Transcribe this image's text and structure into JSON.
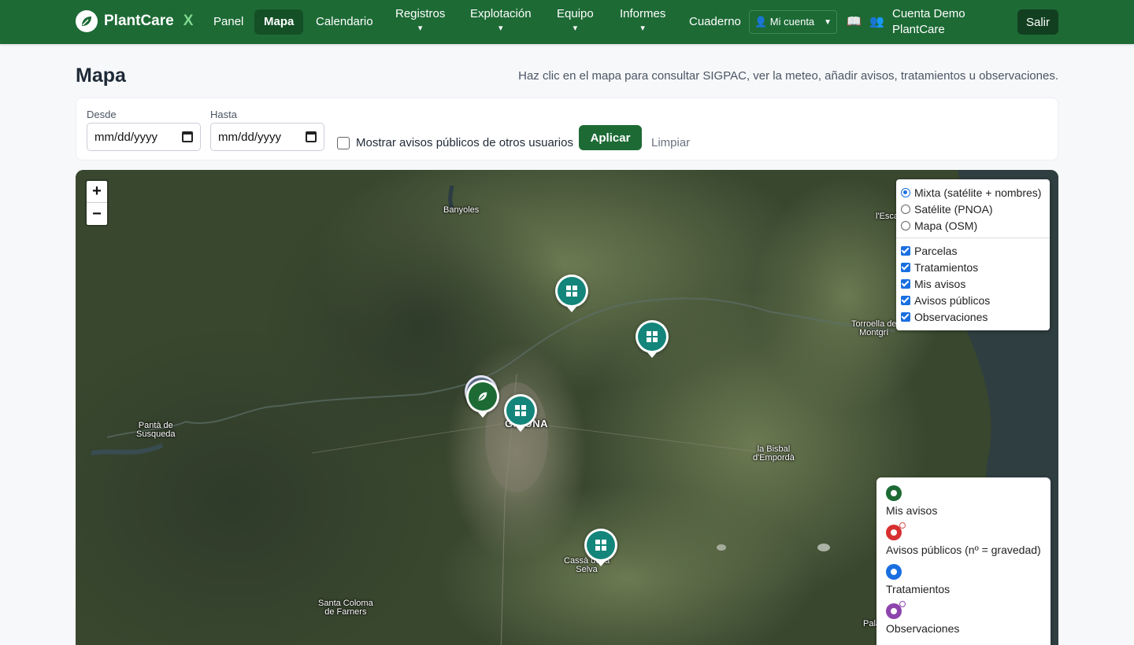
{
  "brand": {
    "name": "PlantCare",
    "suffix": "X"
  },
  "nav": {
    "panel": "Panel",
    "mapa": "Mapa",
    "calendario": "Calendario",
    "registros": "Registros",
    "explotacion": "Explotación",
    "equipo": "Equipo",
    "informes": "Informes",
    "cuaderno": "Cuaderno",
    "caret": "▾",
    "account_select": "👤 Mi cuenta",
    "book_icon": "📖",
    "users_icon": "👥",
    "user_name": "Cuenta Demo PlantCare",
    "logout": "Salir"
  },
  "page": {
    "title": "Mapa",
    "hint": "Haz clic en el mapa para consultar SIGPAC, ver la meteo, añadir avisos, tratamientos u observaciones."
  },
  "filters": {
    "from_label": "Desde",
    "from_value": "mm/dd/yyyy",
    "to_label": "Hasta",
    "to_value": "mm/dd/yyyy",
    "public_label": "Mostrar avisos públicos de otros usuarios",
    "public_checked": false,
    "apply": "Aplicar",
    "clear": "Limpiar"
  },
  "map": {
    "zoom_in": "+",
    "zoom_out": "−",
    "places": {
      "banyoles": "Banyoles",
      "lescala": "l'Escala",
      "torroella_1": "Torroella de",
      "torroella_2": "Montgrí",
      "pantano_1": "Pantà de",
      "pantano_2": "Susqueda",
      "girona": "GIRONA",
      "bisbal_1": "la Bisbal",
      "bisbal_2": "d'Empordà",
      "cassa_1": "Cassà de la",
      "cassa_2": "Selva",
      "santa_coloma_1": "Santa Coloma",
      "santa_coloma_2": "de Farners",
      "palamos": "Palamós"
    },
    "base_layers": [
      {
        "label": "Mixta (satélite + nombres)",
        "selected": true
      },
      {
        "label": "Satélite (PNOA)",
        "selected": false
      },
      {
        "label": "Mapa (OSM)",
        "selected": false
      }
    ],
    "overlays": [
      {
        "label": "Parcelas",
        "checked": true
      },
      {
        "label": "Tratamientos",
        "checked": true
      },
      {
        "label": "Mis avisos",
        "checked": true
      },
      {
        "label": "Avisos públicos",
        "checked": true
      },
      {
        "label": "Observaciones",
        "checked": true
      }
    ]
  },
  "legend": {
    "items": [
      {
        "label": "Mis avisos",
        "color": "#1d6a35"
      },
      {
        "label": "Avisos públicos (nº = gravedad)",
        "color": "#d63031"
      },
      {
        "label": "Tratamientos",
        "color": "#1a6fe0"
      },
      {
        "label": "Observaciones",
        "color": "#8e44ad"
      }
    ]
  },
  "colors": {
    "navbar": "#1d6a35",
    "primary": "#1d6a35",
    "parcel_marker": "#14857a"
  }
}
